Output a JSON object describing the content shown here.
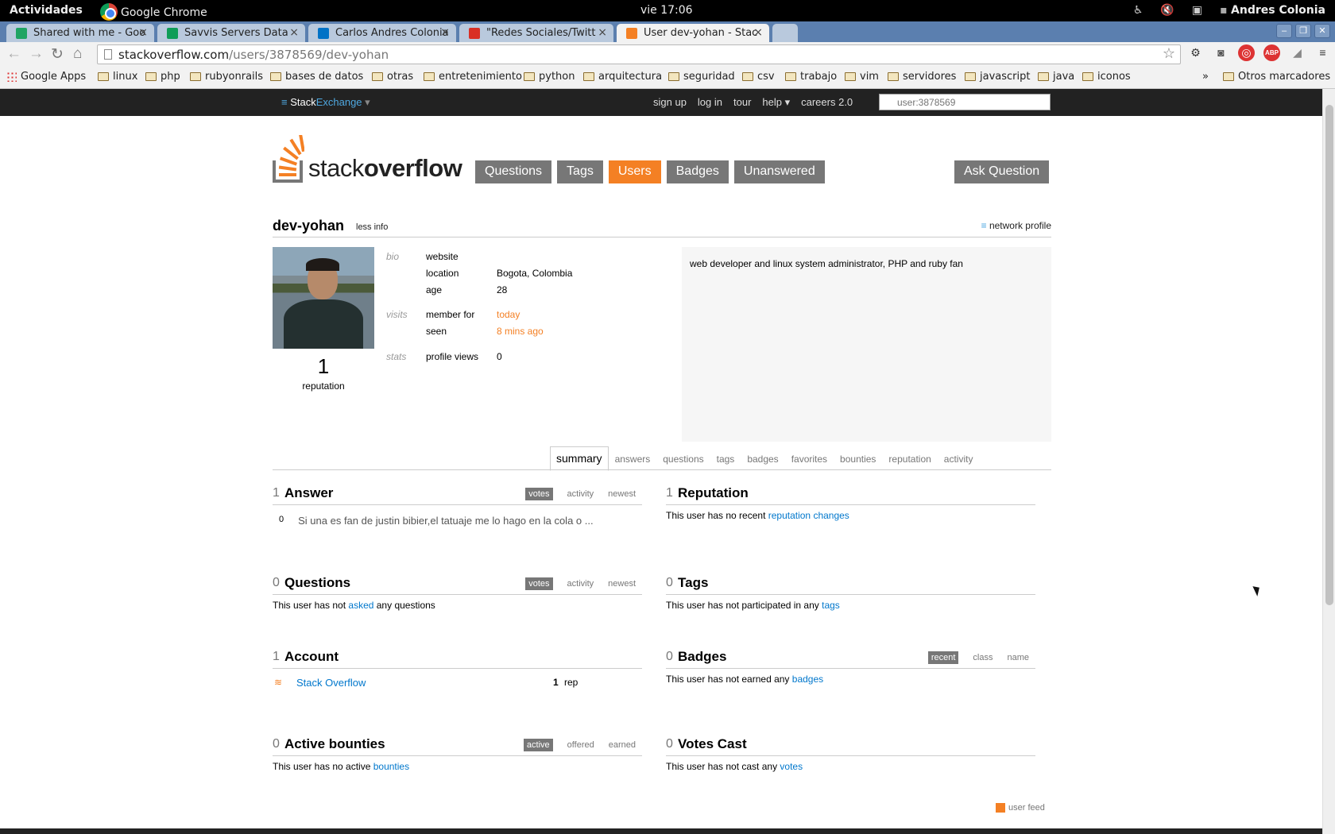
{
  "os": {
    "activities": "Actividades",
    "app_name": "Google Chrome",
    "clock": "vie 17:06",
    "user": "Andres Colonia"
  },
  "tabs": [
    {
      "label": "Shared with me - Goo",
      "favicon_color": "#1fa463"
    },
    {
      "label": "Savvis Servers Data",
      "favicon_color": "#0f9d58"
    },
    {
      "label": "Carlos Andres Colonia",
      "favicon_color": "#0072c6"
    },
    {
      "label": "\"Redes Sociales/Twitt",
      "favicon_color": "#d93025"
    },
    {
      "label": "User dev-yohan - Stac",
      "favicon_color": "#f48024"
    }
  ],
  "address": {
    "host": "stackoverflow.com",
    "path": "/users/3878569/dev-yohan"
  },
  "bookmarks": [
    {
      "label": "Google Apps",
      "icon": "apps-icon"
    },
    {
      "label": "linux"
    },
    {
      "label": "php"
    },
    {
      "label": "rubyonrails"
    },
    {
      "label": "bases de datos"
    },
    {
      "label": "otras"
    },
    {
      "label": "entretenimiento"
    },
    {
      "label": "python"
    },
    {
      "label": "arquitectura"
    },
    {
      "label": "seguridad"
    },
    {
      "label": "csv"
    },
    {
      "label": "trabajo"
    },
    {
      "label": "vim"
    },
    {
      "label": "servidores"
    },
    {
      "label": "javascript"
    },
    {
      "label": "java"
    },
    {
      "label": "iconos"
    }
  ],
  "bookmarks_more": "»",
  "bookmarks_other": "Otros marcadores",
  "se_bar": {
    "logo_stack": "Stack",
    "logo_exchange": "Exchange",
    "menu": [
      "sign up",
      "log in",
      "tour",
      "help ▾",
      "careers 2.0"
    ],
    "search_placeholder": "user:3878569"
  },
  "logo": {
    "stack": "stack",
    "overflow": "overflow"
  },
  "nav": [
    "Questions",
    "Tags",
    "Users",
    "Badges",
    "Unanswered"
  ],
  "nav_active": "Users",
  "ask_question": "Ask Question",
  "user": {
    "name": "dev-yohan",
    "less_info": "less info",
    "network_profile": "network profile",
    "reputation": "1",
    "reputation_label": "reputation",
    "bio_section": "bio",
    "visits_section": "visits",
    "stats_section": "stats",
    "website_label": "website",
    "location_label": "location",
    "location": "Bogota, Colombia",
    "age_label": "age",
    "age": "28",
    "member_for_label": "member for",
    "member_for": "today",
    "seen_label": "seen",
    "seen": "8 mins ago",
    "profile_views_label": "profile views",
    "profile_views": "0",
    "about": "web developer and linux system administrator, PHP and ruby fan"
  },
  "subtabs": [
    "summary",
    "answers",
    "questions",
    "tags",
    "badges",
    "favorites",
    "bounties",
    "reputation",
    "activity"
  ],
  "panels": {
    "answers": {
      "count": "1",
      "title": "Answer",
      "opts": [
        "votes",
        "activity",
        "newest"
      ],
      "item_score": "0",
      "item_text": "Si una es fan de justin bibier,el tatuaje me lo hago en la cola o ..."
    },
    "reputation": {
      "count": "1",
      "title": "Reputation",
      "text": "This user has no recent ",
      "link": "reputation changes"
    },
    "questions": {
      "count": "0",
      "title": "Questions",
      "opts": [
        "votes",
        "activity",
        "newest"
      ],
      "text_a": "This user has not ",
      "link": "asked",
      "text_b": " any questions"
    },
    "tags": {
      "count": "0",
      "title": "Tags",
      "text": "This user has not participated in any ",
      "link": "tags"
    },
    "accounts": {
      "count": "1",
      "title": "Account",
      "site": "Stack Overflow",
      "rep": "1",
      "rep_label": "rep"
    },
    "badges": {
      "count": "0",
      "title": "Badges",
      "opts": [
        "recent",
        "class",
        "name"
      ],
      "text": "This user has not earned any ",
      "link": "badges"
    },
    "bounties": {
      "count": "0",
      "title": "Active bounties",
      "opts": [
        "active",
        "offered",
        "earned"
      ],
      "text": "This user has no active ",
      "link": "bounties"
    },
    "votes": {
      "count": "0",
      "title": "Votes Cast",
      "text": "This user has not cast any ",
      "link": "votes"
    }
  },
  "user_feed": "user feed",
  "colors": {
    "accent": "#f48024",
    "link": "#0077cc",
    "tag_grey": "#777777"
  }
}
